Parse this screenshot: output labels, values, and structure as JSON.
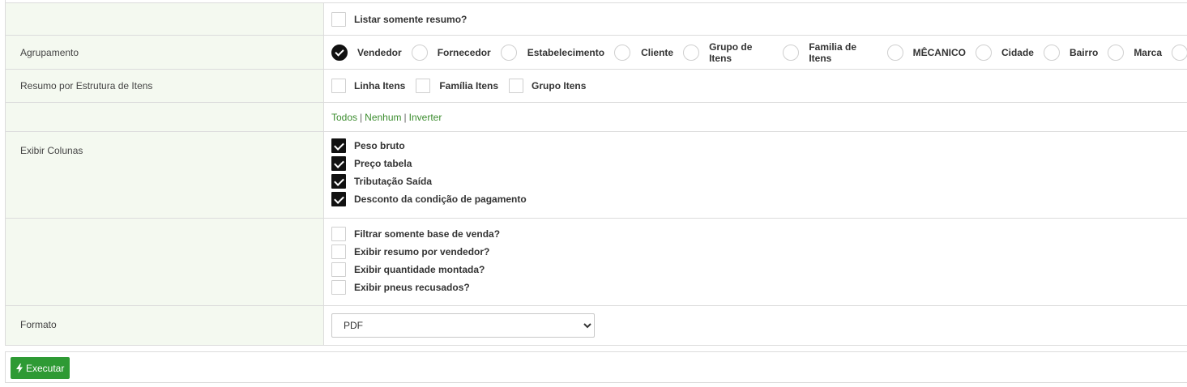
{
  "rows": {
    "summary": {
      "label": "",
      "option": {
        "label": "Listar somente resumo?",
        "checked": false
      }
    },
    "grouping": {
      "label": "Agrupamento",
      "options": [
        {
          "label": "Vendedor",
          "selected": true
        },
        {
          "label": "Fornecedor",
          "selected": false
        },
        {
          "label": "Estabelecimento",
          "selected": false
        },
        {
          "label": "Cliente",
          "selected": false
        },
        {
          "label": "Grupo de Itens",
          "selected": false
        },
        {
          "label": "Familia de Itens",
          "selected": false
        },
        {
          "label": "MÊCANICO",
          "selected": false
        },
        {
          "label": "Cidade",
          "selected": false
        },
        {
          "label": "Bairro",
          "selected": false
        },
        {
          "label": "Marca",
          "selected": false
        }
      ]
    },
    "item_structure": {
      "label": "Resumo por Estrutura de Itens",
      "options": [
        {
          "label": "Linha Itens",
          "checked": false
        },
        {
          "label": "Família Itens",
          "checked": false
        },
        {
          "label": "Grupo Itens",
          "checked": false
        }
      ]
    },
    "selection_links": {
      "all": "Todos",
      "none": "Nenhum",
      "invert": "Inverter",
      "separator": "|"
    },
    "columns": {
      "label": "Exibir Colunas",
      "options": [
        {
          "label": "Peso bruto",
          "checked": true
        },
        {
          "label": "Preço tabela",
          "checked": true
        },
        {
          "label": "Tributação Saída",
          "checked": true
        },
        {
          "label": "Desconto da condição de pagamento",
          "checked": true
        }
      ]
    },
    "filters": {
      "label": "",
      "options": [
        {
          "label": "Filtrar somente base de venda?",
          "checked": false
        },
        {
          "label": "Exibir resumo por vendedor?",
          "checked": false
        },
        {
          "label": "Exibir quantidade montada?",
          "checked": false
        },
        {
          "label": "Exibir pneus recusados?",
          "checked": false
        }
      ]
    },
    "format": {
      "label": "Formato",
      "selected": "PDF"
    }
  },
  "footer": {
    "run_button": "Executar",
    "run_icon": "bolt-icon"
  },
  "colors": {
    "accent": "#2e9a34",
    "link": "#3c8d2f",
    "label_bg": "#f4f9f0"
  }
}
